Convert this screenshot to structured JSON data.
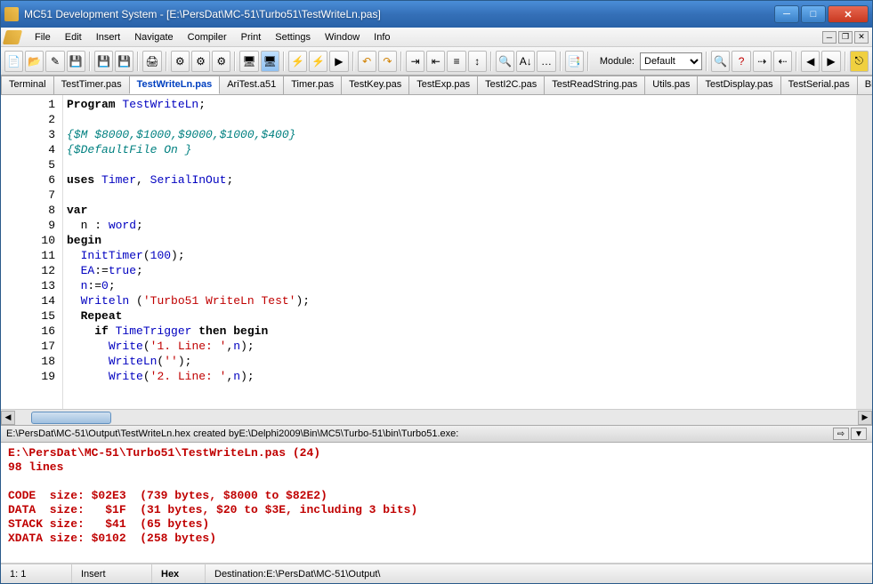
{
  "window": {
    "title": "MC51 Development System - [E:\\PersDat\\MC-51\\Turbo51\\TestWriteLn.pas]"
  },
  "menu": {
    "items": [
      "File",
      "Edit",
      "Insert",
      "Navigate",
      "Compiler",
      "Print",
      "Settings",
      "Window",
      "Info"
    ]
  },
  "toolbar": {
    "module_label": "Module:",
    "module_value": "Default"
  },
  "tabs": {
    "items": [
      "Terminal",
      "TestTimer.pas",
      "TestWriteLn.pas",
      "AriTest.a51",
      "Timer.pas",
      "TestKey.pas",
      "TestExp.pas",
      "TestI2C.pas",
      "TestReadString.pas",
      "Utils.pas",
      "TestDisplay.pas",
      "TestSerial.pas",
      "Blink-"
    ],
    "active_index": 2
  },
  "code": {
    "lines": [
      {
        "n": 1,
        "tokens": [
          {
            "t": "Program ",
            "c": "kw"
          },
          {
            "t": "TestWriteLn",
            "c": "id"
          },
          {
            "t": ";",
            "c": ""
          }
        ]
      },
      {
        "n": 2,
        "tokens": []
      },
      {
        "n": 3,
        "tokens": [
          {
            "t": "{$M $8000,$1000,$9000,$1000,$400}",
            "c": "cm"
          }
        ]
      },
      {
        "n": 4,
        "tokens": [
          {
            "t": "{$DefaultFile On }",
            "c": "cm"
          }
        ]
      },
      {
        "n": 5,
        "tokens": []
      },
      {
        "n": 6,
        "tokens": [
          {
            "t": "uses ",
            "c": "kw"
          },
          {
            "t": "Timer",
            "c": "id"
          },
          {
            "t": ", ",
            "c": ""
          },
          {
            "t": "SerialInOut",
            "c": "id"
          },
          {
            "t": ";",
            "c": ""
          }
        ]
      },
      {
        "n": 7,
        "tokens": []
      },
      {
        "n": 8,
        "tokens": [
          {
            "t": "var",
            "c": "kw"
          }
        ]
      },
      {
        "n": 9,
        "tokens": [
          {
            "t": "  n : ",
            "c": ""
          },
          {
            "t": "word",
            "c": "id"
          },
          {
            "t": ";",
            "c": ""
          }
        ]
      },
      {
        "n": 10,
        "tokens": [
          {
            "t": "begin",
            "c": "kw"
          }
        ]
      },
      {
        "n": 11,
        "tokens": [
          {
            "t": "  ",
            "c": ""
          },
          {
            "t": "InitTimer",
            "c": "id"
          },
          {
            "t": "(",
            "c": ""
          },
          {
            "t": "100",
            "c": "num"
          },
          {
            "t": ");",
            "c": ""
          }
        ]
      },
      {
        "n": 12,
        "tokens": [
          {
            "t": "  ",
            "c": ""
          },
          {
            "t": "EA",
            "c": "id"
          },
          {
            "t": ":=",
            "c": ""
          },
          {
            "t": "true",
            "c": "id"
          },
          {
            "t": ";",
            "c": ""
          }
        ]
      },
      {
        "n": 13,
        "tokens": [
          {
            "t": "  ",
            "c": ""
          },
          {
            "t": "n",
            "c": "id"
          },
          {
            "t": ":=",
            "c": ""
          },
          {
            "t": "0",
            "c": "num"
          },
          {
            "t": ";",
            "c": ""
          }
        ]
      },
      {
        "n": 14,
        "tokens": [
          {
            "t": "  ",
            "c": ""
          },
          {
            "t": "Writeln ",
            "c": "id"
          },
          {
            "t": "(",
            "c": ""
          },
          {
            "t": "'Turbo51 WriteLn Test'",
            "c": "str"
          },
          {
            "t": ");",
            "c": ""
          }
        ]
      },
      {
        "n": 15,
        "tokens": [
          {
            "t": "  ",
            "c": ""
          },
          {
            "t": "Repeat",
            "c": "kw"
          }
        ]
      },
      {
        "n": 16,
        "tokens": [
          {
            "t": "    ",
            "c": ""
          },
          {
            "t": "if ",
            "c": "kw"
          },
          {
            "t": "TimeTrigger ",
            "c": "id"
          },
          {
            "t": "then begin",
            "c": "kw"
          }
        ]
      },
      {
        "n": 17,
        "tokens": [
          {
            "t": "      ",
            "c": ""
          },
          {
            "t": "Write",
            "c": "id"
          },
          {
            "t": "(",
            "c": ""
          },
          {
            "t": "'1. Line: '",
            "c": "str"
          },
          {
            "t": ",",
            "c": ""
          },
          {
            "t": "n",
            "c": "id"
          },
          {
            "t": ");",
            "c": ""
          }
        ]
      },
      {
        "n": 18,
        "tokens": [
          {
            "t": "      ",
            "c": ""
          },
          {
            "t": "WriteLn",
            "c": "id"
          },
          {
            "t": "(",
            "c": ""
          },
          {
            "t": "''",
            "c": "str"
          },
          {
            "t": ");",
            "c": ""
          }
        ]
      },
      {
        "n": 19,
        "tokens": [
          {
            "t": "      ",
            "c": ""
          },
          {
            "t": "Write",
            "c": "id"
          },
          {
            "t": "(",
            "c": ""
          },
          {
            "t": "'2. Line: '",
            "c": "str"
          },
          {
            "t": ",",
            "c": ""
          },
          {
            "t": "n",
            "c": "id"
          },
          {
            "t": ");",
            "c": ""
          }
        ]
      }
    ]
  },
  "output": {
    "header": "E:\\PersDat\\MC-51\\Output\\TestWriteLn.hex created byE:\\Delphi2009\\Bin\\MC5\\Turbo-51\\bin\\Turbo51.exe:",
    "lines": [
      "E:\\PersDat\\MC-51\\Turbo51\\TestWriteLn.pas (24)",
      "98 lines",
      "",
      "CODE  size: $02E3  (739 bytes, $8000 to $82E2)",
      "DATA  size:   $1F  (31 bytes, $20 to $3E, including 3 bits)",
      "STACK size:   $41  (65 bytes)",
      "XDATA size: $0102  (258 bytes)"
    ]
  },
  "status": {
    "position": "1: 1",
    "mode": "Insert",
    "format": "Hex",
    "destination": "Destination:E:\\PersDat\\MC-51\\Output\\"
  }
}
